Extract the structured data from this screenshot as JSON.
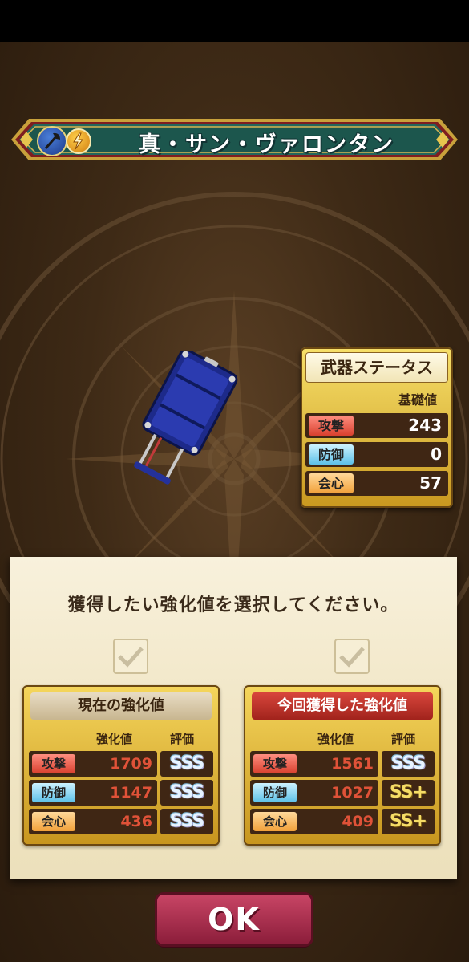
{
  "title": {
    "weapon_name": "真・サン・ヴァロンタン",
    "weapon_type_icon": "axe-icon",
    "element_icon": "lightning-icon"
  },
  "status": {
    "header": "武器ステータス",
    "column_label": "基礎値",
    "rows": [
      {
        "label": "攻撃",
        "value": "243"
      },
      {
        "label": "防御",
        "value": "0"
      },
      {
        "label": "会心",
        "value": "57"
      }
    ]
  },
  "dialog": {
    "prompt": "獲得したい強化値を選択してください。",
    "current": {
      "header": "現在の強化値",
      "col_value": "強化値",
      "col_rank": "評価",
      "rows": [
        {
          "label": "攻撃",
          "value": "1709",
          "rank": "SSS"
        },
        {
          "label": "防御",
          "value": "1147",
          "rank": "SSS"
        },
        {
          "label": "会心",
          "value": "436",
          "rank": "SSS"
        }
      ]
    },
    "new": {
      "header": "今回獲得した強化値",
      "col_value": "強化値",
      "col_rank": "評価",
      "rows": [
        {
          "label": "攻撃",
          "value": "1561",
          "rank": "SSS"
        },
        {
          "label": "防御",
          "value": "1027",
          "rank": "SS+"
        },
        {
          "label": "会心",
          "value": "409",
          "rank": "SS+"
        }
      ]
    }
  },
  "ok_button": "OK",
  "colors": {
    "banner": "#1f5f55",
    "gold": "#e0b23a",
    "attack": "#d9402e",
    "defense": "#5cc0e8",
    "critical": "#f2a13a",
    "ok": "#a82a48"
  }
}
